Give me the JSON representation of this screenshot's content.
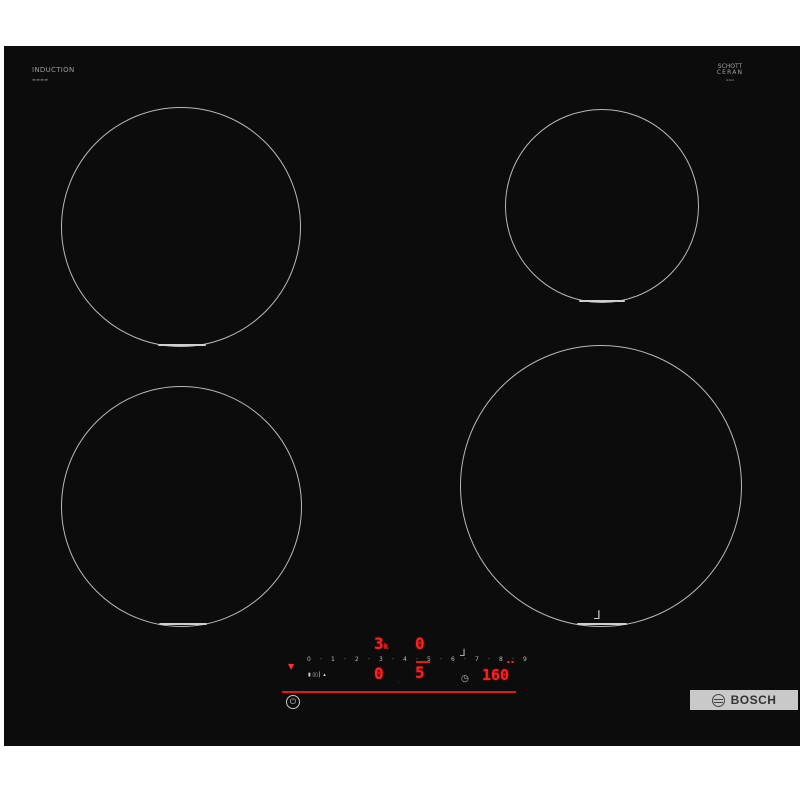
{
  "brand": {
    "top_left_title": "INDUCTION",
    "top_right_line1": "SCHOTT",
    "top_right_line2": "CERAN",
    "logo_text": "BOSCH"
  },
  "display": {
    "zone_top_left_left": "3",
    "zone_top_left_suffix": "k",
    "zone_top_right": "0",
    "zone_bottom_left": "0",
    "zone_bottom_right": "5",
    "timer": "160"
  },
  "scale": [
    "0",
    "1",
    "2",
    "3",
    "4",
    "5",
    "6",
    "7",
    "8",
    "9"
  ],
  "colors": {
    "hob": "#0c0c0c",
    "zone_ring": "#b9b9b9",
    "display_red": "#ff2020",
    "logo_bar": "#c9c9c9"
  },
  "icons": [
    "power-icon",
    "wifi-icon",
    "timer-icon",
    "fry-sensor-icon",
    "bosch-logo-icon"
  ]
}
